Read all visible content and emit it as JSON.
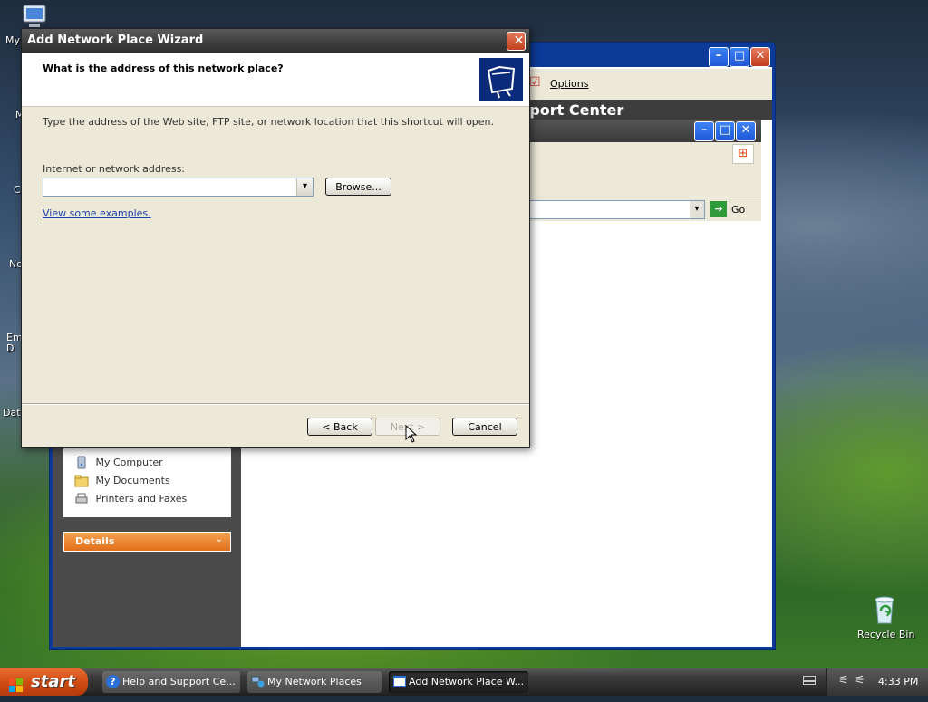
{
  "desktop": {
    "icons": [
      {
        "label": "My",
        "icon": "my-computer-icon"
      },
      {
        "label": "M"
      },
      {
        "label": "C"
      },
      {
        "label": "No"
      },
      {
        "label": "Em\nD"
      },
      {
        "label": "Data"
      }
    ],
    "recycle_bin": {
      "label": "Recycle Bin",
      "icon": "recycle-bin-icon"
    }
  },
  "back_window": {
    "toolbar_options": "Options",
    "header_partial": "Help and Support Center",
    "address_go": "Go",
    "sidebar": {
      "places": [
        "My Computer",
        "My Documents",
        "Printers and Faxes"
      ],
      "details_label": "Details"
    }
  },
  "dialog": {
    "title": "Add Network Place Wizard",
    "heading": "What is the address of this network place?",
    "instruction": "Type the address of the Web site, FTP site, or network location that this shortcut will open.",
    "address_label": "Internet or network address:",
    "address_value": "",
    "browse_label": "Browse...",
    "examples_link": "View some examples.",
    "back_label": "< Back",
    "next_label": "Next >",
    "cancel_label": "Cancel"
  },
  "taskbar": {
    "start_label": "start",
    "tasks": [
      {
        "label": "Help and Support Ce...",
        "icon": "help-icon"
      },
      {
        "label": "My Network Places",
        "icon": "network-places-icon"
      },
      {
        "label": "Add Network Place W...",
        "icon": "wizard-window-icon",
        "active": true
      }
    ],
    "clock": "4:33 PM"
  },
  "colors": {
    "dialog_bg": "#ece9d8",
    "title_bar": "#3d3d3d",
    "sidebar_panel": "#4b4b4b",
    "details_bar": "#e8751f",
    "go_arrow": "#2f9a3a"
  }
}
